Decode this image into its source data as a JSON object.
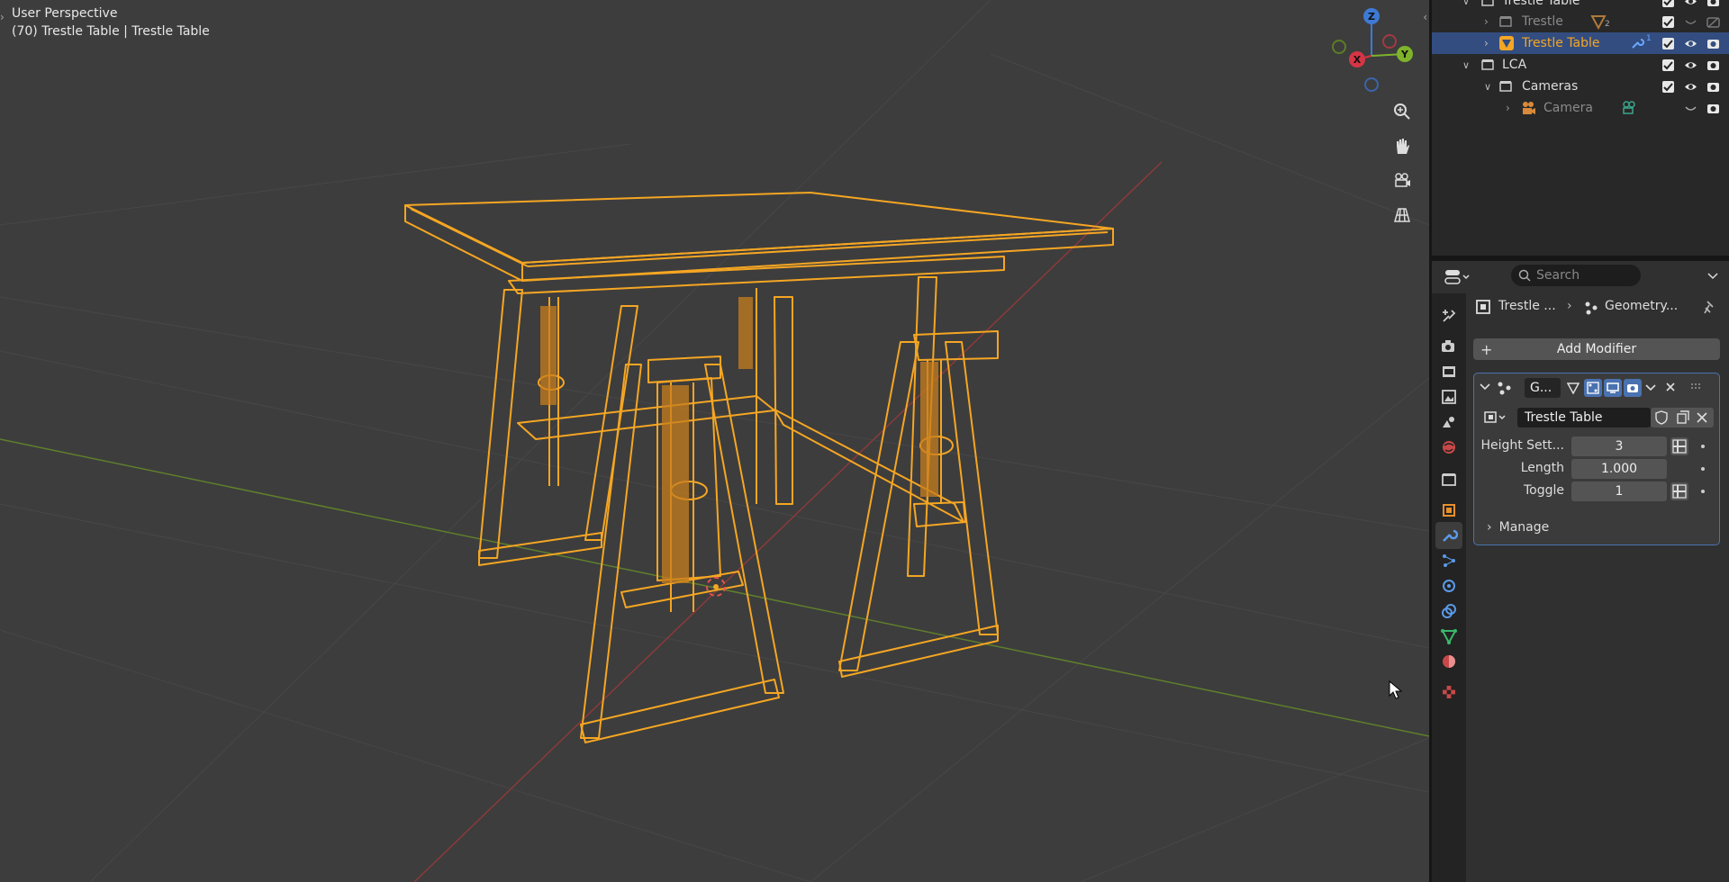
{
  "viewport": {
    "title": "User Perspective",
    "subtitle": "(70) Trestle Table | Trestle Table",
    "gizmo": {
      "z": "Z",
      "y": "Y",
      "x": "X"
    },
    "nav_icons": [
      "zoom-icon",
      "hand-pan-icon",
      "camera-view-icon",
      "ortho-grid-icon"
    ]
  },
  "outliner": {
    "rows": [
      {
        "label": "Trestle Table",
        "level": 1,
        "dim": false
      },
      {
        "label": "Trestle",
        "level": 2,
        "dim": true,
        "badge": "2"
      },
      {
        "label": "Trestle Table",
        "level": 2,
        "selected": true,
        "badge": "1"
      },
      {
        "label": "LCA",
        "level": 1
      },
      {
        "label": "Cameras",
        "level": 2
      },
      {
        "label": "Camera",
        "level": 3,
        "dim": true
      }
    ]
  },
  "properties": {
    "search_placeholder": "Search",
    "breadcrumb_object": "Trestle ...",
    "breadcrumb_modifier": "Geometry...",
    "add_modifier_label": "Add Modifier",
    "modifier": {
      "name": "G...",
      "node_group": "Trestle Table",
      "inputs": [
        {
          "label": "Height Sett...",
          "value": "3"
        },
        {
          "label": "Length",
          "value": "1.000"
        },
        {
          "label": "Toggle",
          "value": "1"
        }
      ],
      "manage_label": "Manage"
    }
  },
  "colors": {
    "accent_blue": "#4a72b0",
    "selection_orange": "#f5a623",
    "viewport_bg": "#3d3d3d"
  }
}
